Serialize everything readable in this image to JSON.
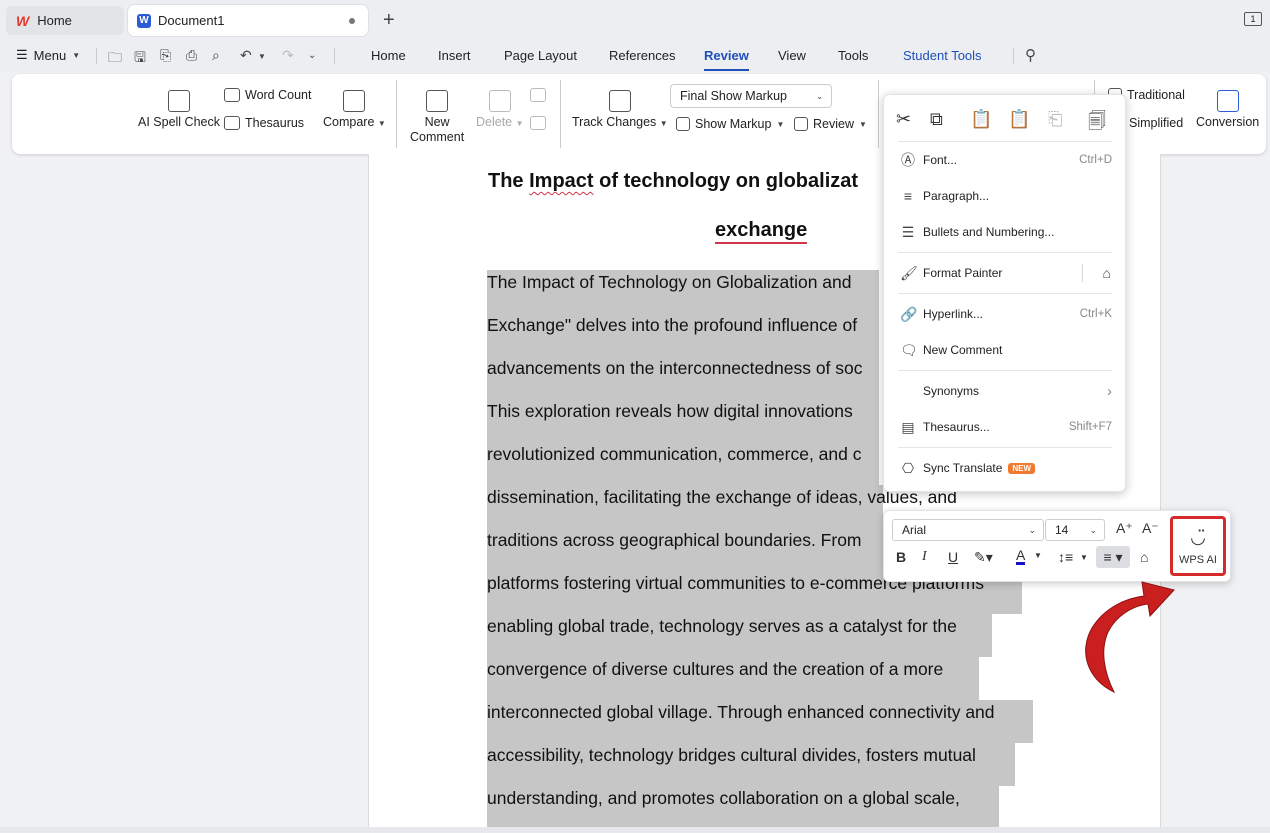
{
  "titlebar": {
    "home_tab": "Home",
    "doc_tab": "Document1",
    "new_tab": "+",
    "window_badge": "1"
  },
  "menubar": {
    "menu_label": "Menu",
    "tabs": [
      "Home",
      "Insert",
      "Page Layout",
      "References",
      "Review",
      "View",
      "Tools",
      "Student Tools"
    ],
    "active_tab": "Review"
  },
  "ribbon": {
    "ai_spell_check": "AI Spell Check",
    "word_count": "Word Count",
    "thesaurus": "Thesaurus",
    "compare": "Compare",
    "new_comment_1": "New",
    "new_comment_2": "Comment",
    "delete": "Delete",
    "track_changes": "Track Changes",
    "markup_select": "Final Show Markup",
    "show_markup": "Show Markup",
    "review": "Review",
    "traditional": "Traditional",
    "simplified": "Simplified",
    "conversion": "Conversion"
  },
  "document": {
    "title_line1": "The Impact of technology on globalizat",
    "title_line1_word": "Impact",
    "title_line2": "exchange",
    "lines": [
      "The Impact of Technology on Globalization and",
      "Exchange\" delves into the profound influence of",
      "advancements on the interconnectedness of soc",
      "This exploration reveals how digital innovations",
      "revolutionized communication, commerce, and c",
      "dissemination, facilitating the exchange of ideas, values, and",
      "traditions across geographical boundaries. From",
      "platforms fostering virtual communities to e-commerce platforms",
      "enabling global trade, technology serves as a catalyst for the",
      "convergence of diverse cultures and the creation of a more",
      "interconnected global village. Through enhanced connectivity and",
      "accessibility, technology bridges cultural divides, fosters mutual",
      "understanding, and promotes collaboration on a global scale,"
    ]
  },
  "context_menu": {
    "items": [
      {
        "label": "Font...",
        "shortcut": "Ctrl+D"
      },
      {
        "label": "Paragraph...",
        "shortcut": ""
      },
      {
        "label": "Bullets and Numbering...",
        "shortcut": ""
      },
      {
        "label": "Format Painter",
        "shortcut": ""
      },
      {
        "label": "Hyperlink...",
        "shortcut": "Ctrl+K"
      },
      {
        "label": "New Comment",
        "shortcut": ""
      },
      {
        "label": "Synonyms",
        "shortcut": "›"
      },
      {
        "label": "Thesaurus...",
        "shortcut": "Shift+F7"
      },
      {
        "label": "Sync Translate",
        "shortcut": ""
      }
    ],
    "new_badge": "NEW"
  },
  "mini_toolbar": {
    "font_name": "Arial",
    "font_size": "14",
    "wps_ai": "WPS AI"
  },
  "colors": {
    "accent_blue": "#1f4fb8",
    "highlight_red": "#d62a2a",
    "selection_gray": "#c6c6c6",
    "badge_orange": "#f07a2d"
  }
}
